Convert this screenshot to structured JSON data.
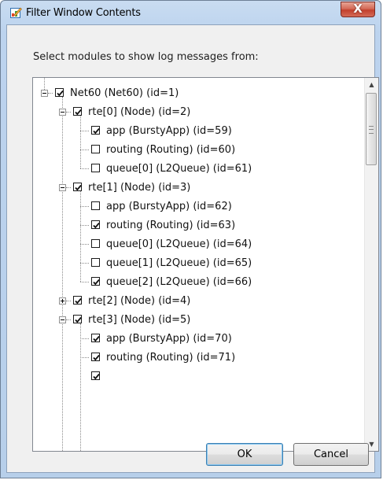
{
  "window": {
    "title": "Filter Window Contents",
    "close_glyph": "X"
  },
  "dialog": {
    "prompt": "Select modules to show log messages from:",
    "ok_label": "OK",
    "cancel_label": "Cancel"
  },
  "tree": {
    "items": [
      {
        "label": "Net60 (Net60) (id=1)",
        "checked": true,
        "expander": "minus"
      },
      {
        "label": "rte[0] (Node) (id=2)",
        "checked": true,
        "expander": "minus"
      },
      {
        "label": "app (BurstyApp) (id=59)",
        "checked": true,
        "expander": null
      },
      {
        "label": "routing (Routing) (id=60)",
        "checked": false,
        "expander": null
      },
      {
        "label": "queue[0] (L2Queue) (id=61)",
        "checked": false,
        "expander": null
      },
      {
        "label": "rte[1] (Node) (id=3)",
        "checked": true,
        "expander": "minus"
      },
      {
        "label": "app (BurstyApp) (id=62)",
        "checked": false,
        "expander": null
      },
      {
        "label": "routing (Routing) (id=63)",
        "checked": true,
        "expander": null
      },
      {
        "label": "queue[0] (L2Queue) (id=64)",
        "checked": false,
        "expander": null
      },
      {
        "label": "queue[1] (L2Queue) (id=65)",
        "checked": false,
        "expander": null
      },
      {
        "label": "queue[2] (L2Queue) (id=66)",
        "checked": true,
        "expander": null
      },
      {
        "label": "rte[2] (Node) (id=4)",
        "checked": true,
        "expander": "plus"
      },
      {
        "label": "rte[3] (Node) (id=5)",
        "checked": true,
        "expander": "minus"
      },
      {
        "label": "app (BurstyApp) (id=70)",
        "checked": true,
        "expander": null
      },
      {
        "label": "routing (Routing) (id=71)",
        "checked": true,
        "expander": null
      }
    ]
  },
  "icons": {
    "title_icon": "filter-edit-icon",
    "scroll_up": "scroll-up-arrow-icon",
    "scroll_down": "scroll-down-arrow-icon"
  },
  "colors": {
    "title_bar": "#bcd3ee",
    "close_button": "#c2402d",
    "default_button_border": "#3c7fb1"
  }
}
